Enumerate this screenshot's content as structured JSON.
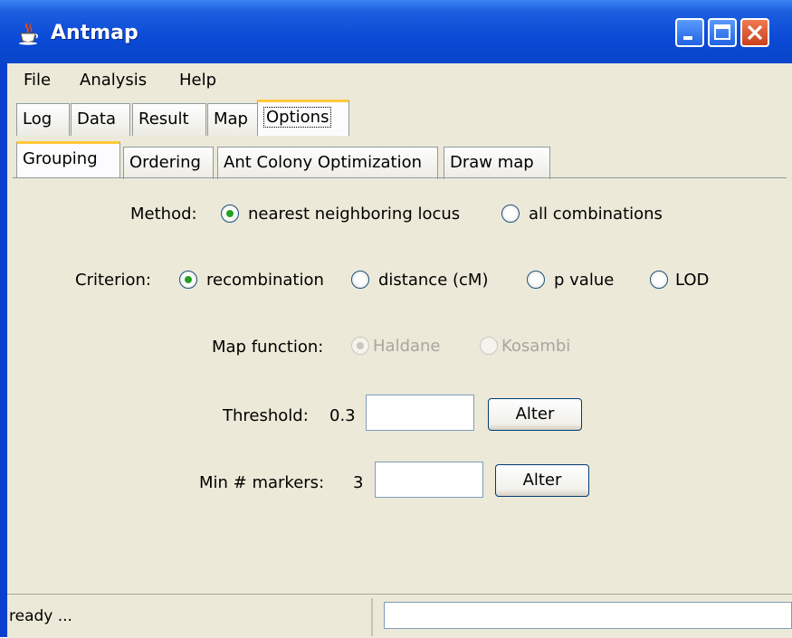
{
  "window": {
    "title": "Antmap",
    "icon": "java-cup-icon",
    "controls": [
      "minimize-icon",
      "maximize-icon",
      "close-icon"
    ]
  },
  "menu": [
    "File",
    "Analysis",
    "Help"
  ],
  "main_tabs": [
    "Log",
    "Data",
    "Result",
    "Map",
    "Options"
  ],
  "main_tab_selected": "Options",
  "sub_tabs": [
    "Grouping",
    "Ordering",
    "Ant Colony Optimization",
    "Draw map"
  ],
  "sub_tab_selected": "Grouping",
  "grouping": {
    "method": {
      "label": "Method:",
      "options": [
        "nearest neighboring locus",
        "all combinations"
      ],
      "selected": "nearest neighboring locus"
    },
    "criterion": {
      "label": "Criterion:",
      "options": [
        "recombination",
        "distance (cM)",
        "p value",
        "LOD"
      ],
      "selected": "recombination"
    },
    "map_function": {
      "label": "Map function:",
      "options": [
        "Haldane",
        "Kosambi"
      ],
      "selected": "Haldane",
      "enabled": false
    },
    "threshold": {
      "label": "Threshold:",
      "value": "0.3",
      "input": "",
      "button": "Alter"
    },
    "min_markers": {
      "label": "Min # markers:",
      "value": "3",
      "input": "",
      "button": "Alter"
    }
  },
  "status": {
    "text": "ready ...",
    "progress": 0
  }
}
